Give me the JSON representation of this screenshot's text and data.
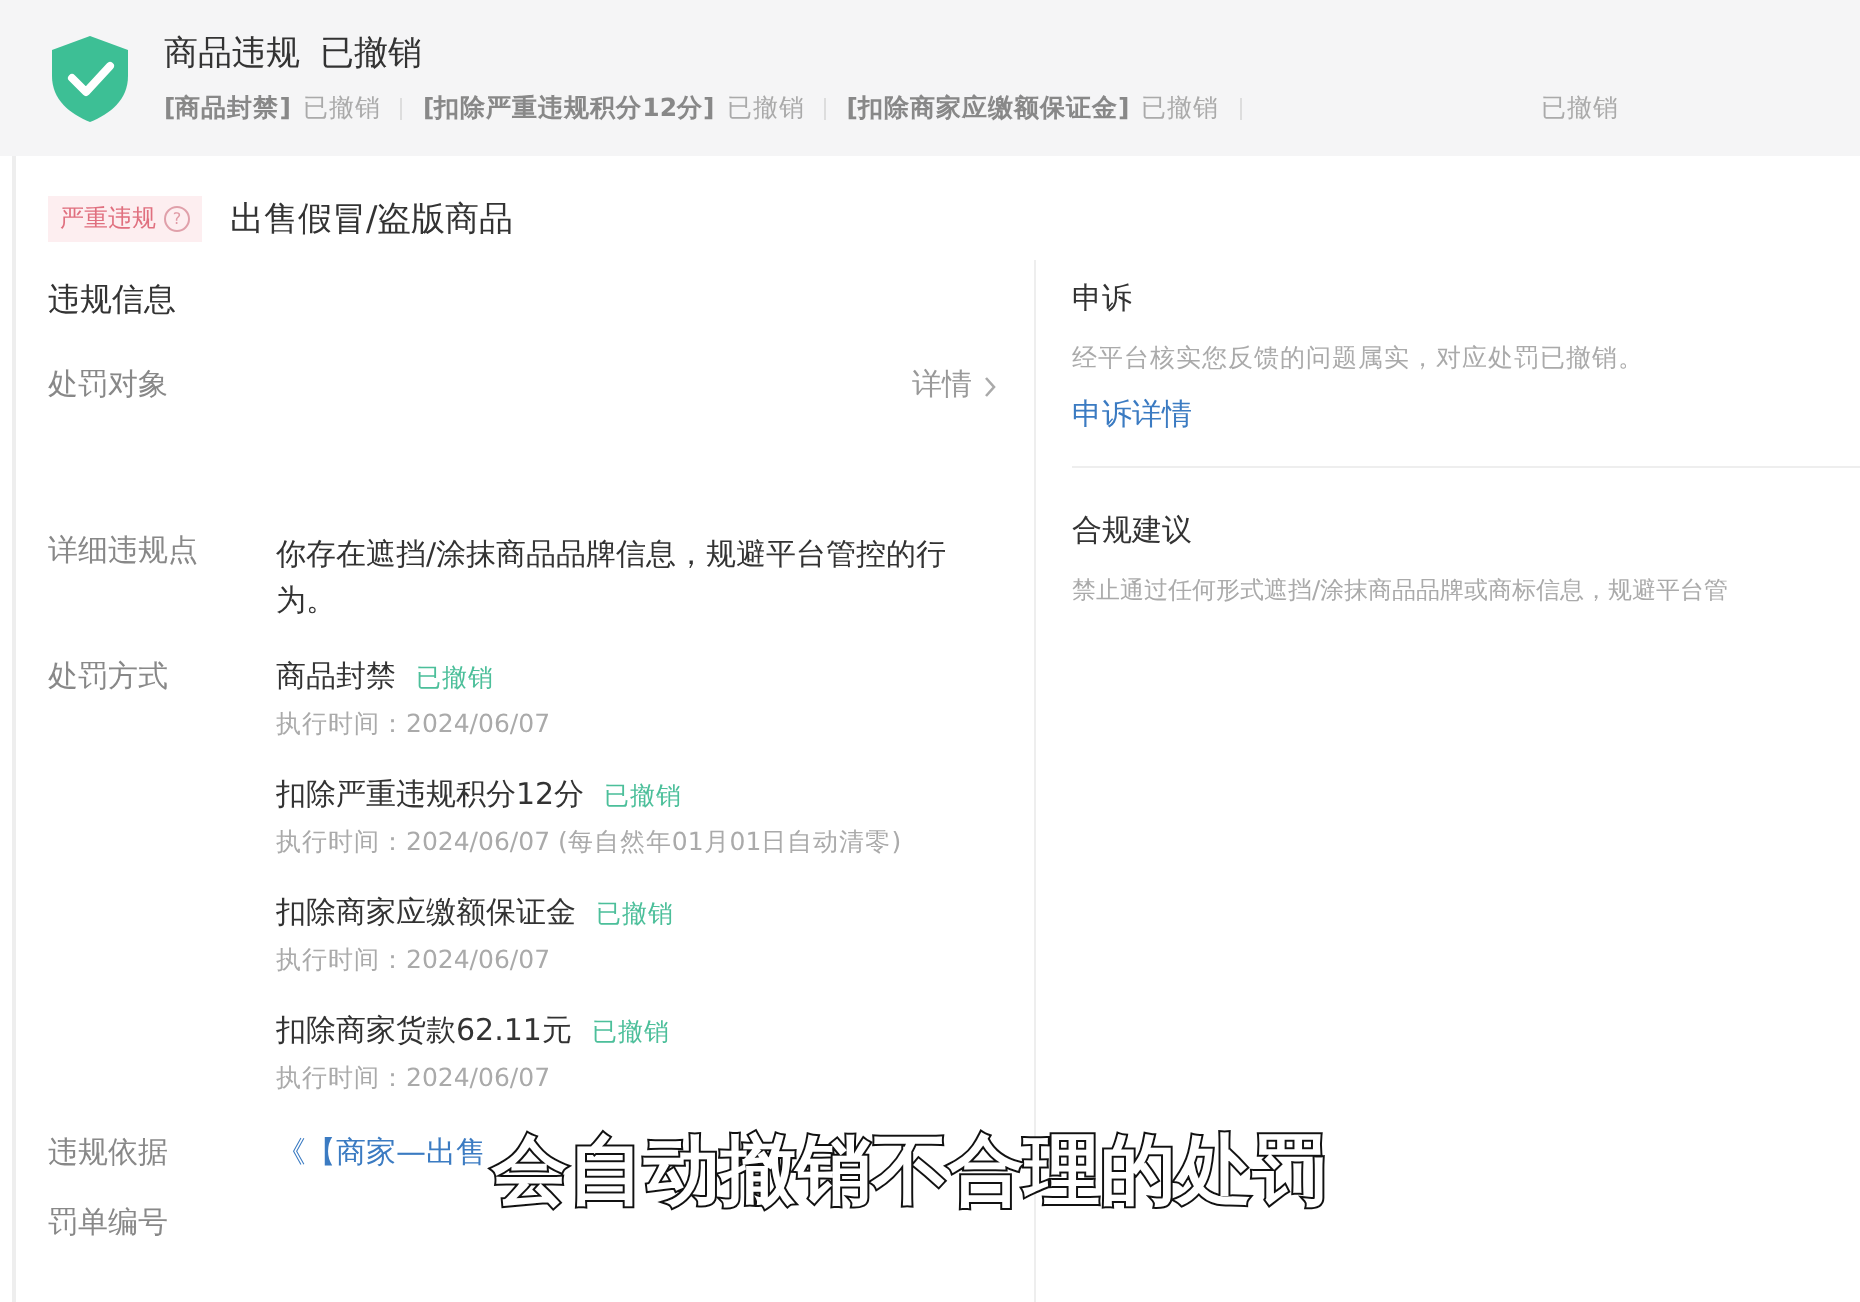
{
  "header": {
    "title": "商品违规",
    "title_status": "已撤销",
    "items": [
      {
        "label": "[商品封禁]",
        "status": "已撤销"
      },
      {
        "label": "[扣除严重违规积分12分]",
        "status": "已撤销"
      },
      {
        "label": "[扣除商家应缴额保证金]",
        "status": "已撤销"
      },
      {
        "status": "已撤销"
      }
    ]
  },
  "violation": {
    "severity_tag": "严重违规",
    "help_icon": "?",
    "title": "出售假冒/盗版商品"
  },
  "info": {
    "heading": "违规信息",
    "target_label": "处罚对象",
    "detail_link": "详情",
    "detail_label": "详细违规点",
    "detail_text": "你存在遮挡/涂抹商品品牌信息，规避平台管控的行为。",
    "penalty_label": "处罚方式",
    "penalties": [
      {
        "name": "商品封禁",
        "status": "已撤销",
        "time": "执行时间：2024/06/07"
      },
      {
        "name": "扣除严重违规积分12分",
        "status": "已撤销",
        "time": "执行时间：2024/06/07 (每自然年01月01日自动清零)"
      },
      {
        "name": "扣除商家应缴额保证金",
        "status": "已撤销",
        "time": "执行时间：2024/06/07"
      },
      {
        "name": "扣除商家货款62.11元",
        "status": "已撤销",
        "time": "执行时间：2024/06/07"
      }
    ],
    "basis_label": "违规依据",
    "basis_link": "《【商家—出售",
    "ticket_label": "罚单编号"
  },
  "appeal": {
    "heading": "申诉",
    "text": "经平台核实您反馈的问题属实，对应处罚已撤销。",
    "link": "申诉详情"
  },
  "advice": {
    "heading": "合规建议",
    "text": "禁止通过任何形式遮挡/涂抹商品品牌或商标信息，规避平台管"
  },
  "caption": "会自动撤销不合理的处罚"
}
